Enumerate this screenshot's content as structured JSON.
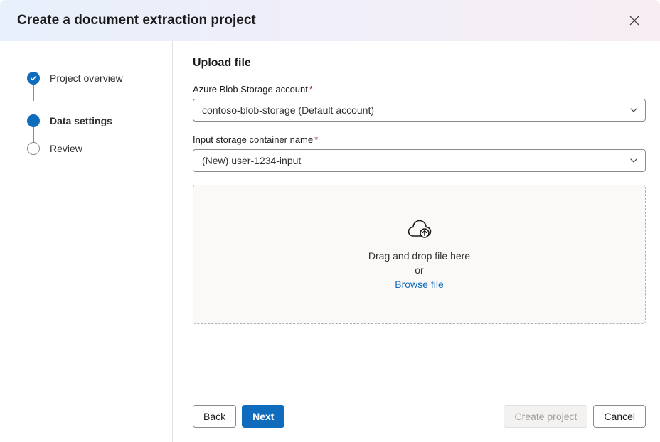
{
  "header": {
    "title": "Create a document extraction project"
  },
  "sidebar": {
    "steps": [
      {
        "label": "Project overview"
      },
      {
        "label": "Data settings"
      },
      {
        "label": "Review"
      }
    ]
  },
  "content": {
    "section_title": "Upload file",
    "storage_account_label": "Azure Blob Storage account",
    "storage_account_value": "contoso-blob-storage (Default account)",
    "container_label": "Input storage container name",
    "container_value": "(New) user-1234-input",
    "dropzone_line1": "Drag and drop file here",
    "dropzone_line2": "or",
    "dropzone_link": "Browse file"
  },
  "footer": {
    "back_label": "Back",
    "next_label": "Next",
    "create_label": "Create project",
    "cancel_label": "Cancel"
  }
}
